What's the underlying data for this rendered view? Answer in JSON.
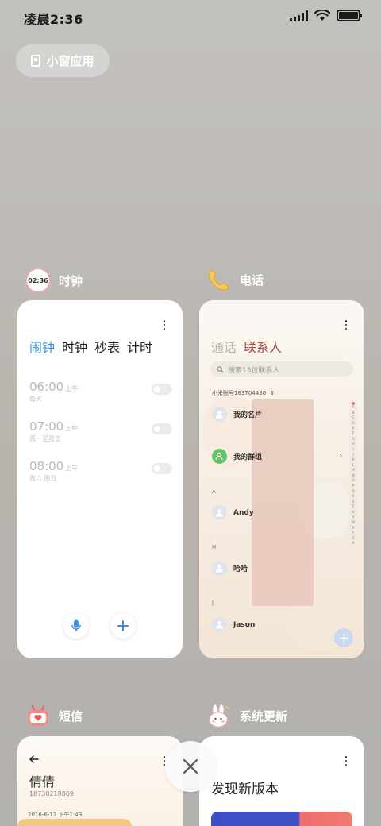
{
  "status_bar": {
    "time": "凌晨2:36"
  },
  "small_window": {
    "label": "小窗应用"
  },
  "apps": {
    "clock": {
      "name": "时钟",
      "icon_text": "02:36",
      "tabs": [
        "闹钟",
        "时钟",
        "秒表",
        "计时"
      ],
      "alarms": [
        {
          "time": "06:00",
          "period": "上午",
          "repeat": "每天"
        },
        {
          "time": "07:00",
          "period": "上午",
          "repeat": "周一至周五"
        },
        {
          "time": "08:00",
          "period": "上午",
          "repeat": "周六 周日"
        }
      ]
    },
    "phone": {
      "name": "电话",
      "tabs": {
        "calls": "通话",
        "contacts": "联系人"
      },
      "search_placeholder": "搜索13位联系人",
      "account_line": "小米账号183704430",
      "my_card": "我的名片",
      "my_groups": "我的群组",
      "contacts": [
        {
          "letter": "A",
          "name": "Andy"
        },
        {
          "letter": "H",
          "name": "哈哈"
        },
        {
          "letter": "J",
          "name": "Jason"
        }
      ],
      "alphabet": [
        "A",
        "B",
        "C",
        "D",
        "E",
        "F",
        "G",
        "H",
        "I",
        "J",
        "K",
        "L",
        "M",
        "N",
        "O",
        "P",
        "Q",
        "R",
        "S",
        "T",
        "U",
        "V",
        "W",
        "X",
        "Y",
        "Z",
        "#"
      ]
    },
    "sms": {
      "name": "短信",
      "contact_name": "倩倩",
      "contact_number": "18730218809",
      "date_line": "2016-6-13 下午1:49"
    },
    "update": {
      "name": "系统更新",
      "title": "发现新版本"
    }
  },
  "colors": {
    "accent_blue": "#3d8fe0",
    "contacts_red": "#a5463c",
    "group_green": "#68c06e"
  }
}
